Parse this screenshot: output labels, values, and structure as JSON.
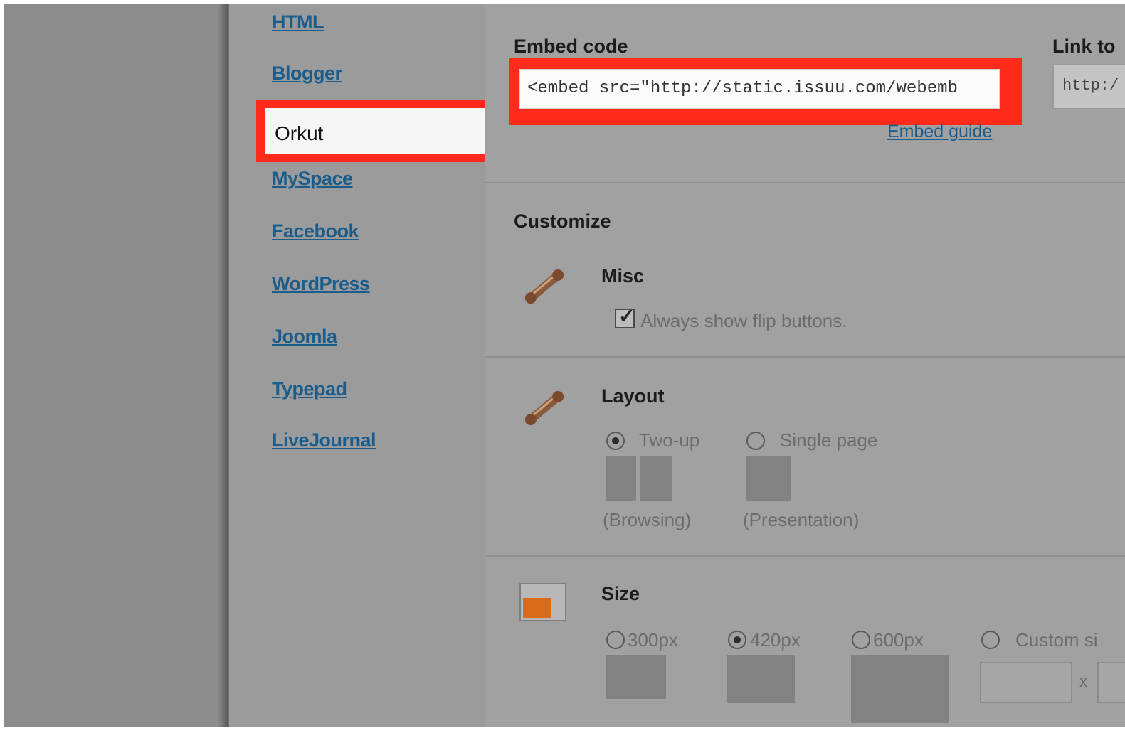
{
  "sidebar": {
    "items": [
      {
        "label": "HTML"
      },
      {
        "label": "Blogger"
      },
      {
        "label": "Orkut"
      },
      {
        "label": "MySpace"
      },
      {
        "label": "Facebook"
      },
      {
        "label": "WordPress"
      },
      {
        "label": "Joomla"
      },
      {
        "label": "Typepad"
      },
      {
        "label": "LiveJournal"
      }
    ]
  },
  "embed": {
    "label": "Embed code",
    "value": "<embed src=\"http://static.issuu.com/webemb",
    "guide_link": "Embed guide"
  },
  "link": {
    "label": "Link to",
    "value": "http:/"
  },
  "customize": {
    "heading": "Customize",
    "misc": {
      "title": "Misc",
      "checkbox_label": "Always show flip buttons.",
      "checked": true
    },
    "layout": {
      "title": "Layout",
      "options": [
        {
          "label": "Two-up",
          "caption": "(Browsing)",
          "selected": true
        },
        {
          "label": "Single page",
          "caption": "(Presentation)",
          "selected": false
        }
      ]
    },
    "size": {
      "title": "Size",
      "options": [
        {
          "label": "300px",
          "selected": false
        },
        {
          "label": "420px",
          "selected": true
        },
        {
          "label": "600px",
          "selected": false
        },
        {
          "label": "Custom si",
          "selected": false
        }
      ],
      "custom_separator": "x"
    }
  },
  "colors": {
    "link": "#1a5d8c",
    "highlight": "#ff2a1a"
  }
}
